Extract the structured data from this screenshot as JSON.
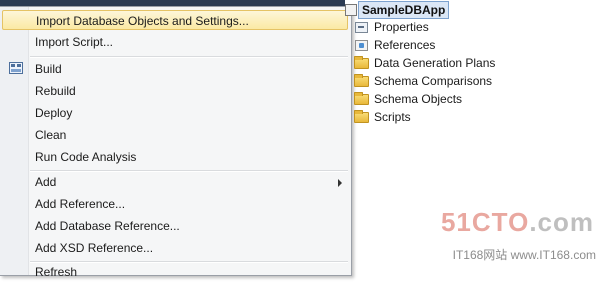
{
  "context_menu": {
    "items": [
      {
        "label": "Import Database Objects and Settings...",
        "highlighted": true,
        "icon": null
      },
      {
        "label": "Import Script...",
        "icon": null
      },
      {
        "label": "Build",
        "icon": "build-icon"
      },
      {
        "label": "Rebuild",
        "icon": null
      },
      {
        "label": "Deploy",
        "icon": null
      },
      {
        "label": "Clean",
        "icon": null
      },
      {
        "label": "Run Code Analysis",
        "icon": null
      },
      {
        "label": "Add",
        "icon": null,
        "submenu": true
      },
      {
        "label": "Add Reference...",
        "icon": null
      },
      {
        "label": "Add Database Reference...",
        "icon": null
      },
      {
        "label": "Add XSD Reference...",
        "icon": null
      },
      {
        "label": "Refresh",
        "icon": null,
        "partially_visible": true
      }
    ]
  },
  "solution_explorer": {
    "project_name": "SampleDBApp",
    "nodes": [
      {
        "label": "Properties",
        "icon": "properties-icon"
      },
      {
        "label": "References",
        "icon": "references-icon"
      },
      {
        "label": "Data Generation Plans",
        "icon": "folder-icon"
      },
      {
        "label": "Schema Comparisons",
        "icon": "folder-icon"
      },
      {
        "label": "Schema Objects",
        "icon": "folder-icon"
      },
      {
        "label": "Scripts",
        "icon": "folder-icon"
      }
    ]
  },
  "watermark": {
    "brand": "51CTO",
    "suffix": ".com",
    "sub": "IT168网站 www.IT168.com"
  },
  "colors": {
    "highlight": "#fbe9a3",
    "menu_background": "#f5f6f7",
    "selection": "#dbe7f6"
  }
}
